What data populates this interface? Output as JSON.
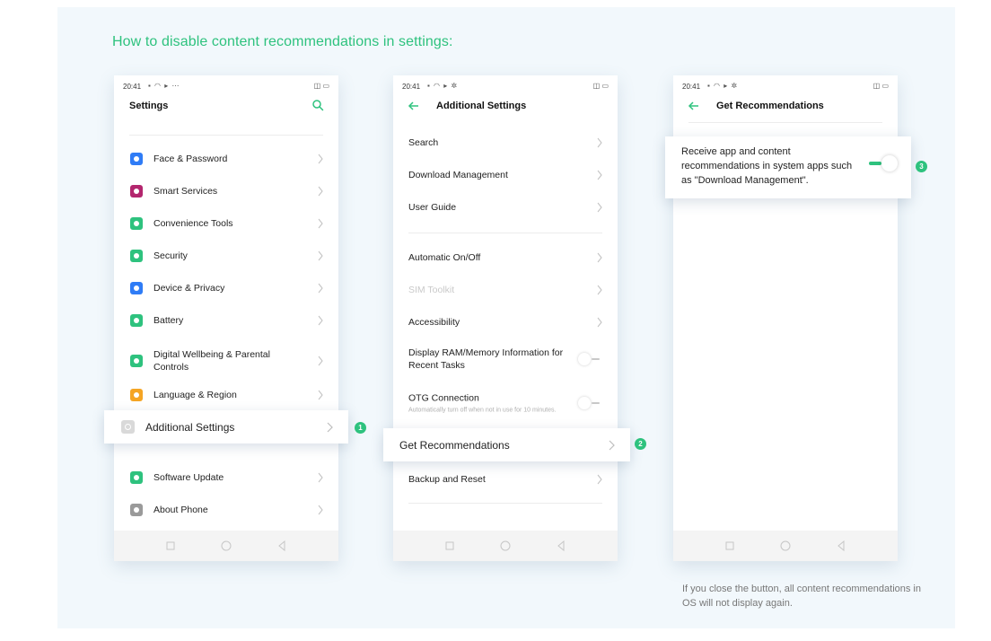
{
  "main_title": "How to disable content recommendations in settings:",
  "status": {
    "time": "20:41"
  },
  "colors": {
    "accent": "#2ec27e"
  },
  "phone1": {
    "title": "Settings",
    "items": [
      {
        "label": "Face & Password",
        "icon": "face-password-icon",
        "color": "#2f7cf6"
      },
      {
        "label": "Smart Services",
        "icon": "smart-services-icon",
        "color": "#b3266e"
      },
      {
        "label": "Convenience Tools",
        "icon": "convenience-tools-icon",
        "color": "#2ec27e"
      },
      {
        "label": "Security",
        "icon": "security-icon",
        "color": "#2ec27e"
      },
      {
        "label": "Device & Privacy",
        "icon": "device-privacy-icon",
        "color": "#2f7cf6"
      },
      {
        "label": "Battery",
        "icon": "battery-icon",
        "color": "#2ec27e"
      },
      {
        "label": "Digital Wellbeing & Parental Controls",
        "icon": "digital-wellbeing-icon",
        "color": "#2ec27e"
      },
      {
        "label": "Language & Region",
        "icon": "language-region-icon",
        "color": "#f5a524"
      }
    ],
    "callout_label": "Additional Settings",
    "bottom_items": [
      {
        "label": "Software Update",
        "icon": "software-update-icon",
        "color": "#2ec27e"
      },
      {
        "label": "About Phone",
        "icon": "about-phone-icon",
        "color": "#9a9a9a"
      }
    ]
  },
  "phone2": {
    "title": "Additional Settings",
    "group1": [
      "Search",
      "Download Management",
      "User Guide"
    ],
    "group2": [
      {
        "label": "Automatic On/Off",
        "type": "chevron"
      },
      {
        "label": "SIM Toolkit",
        "type": "chevron",
        "disabled": true
      },
      {
        "label": "Accessibility",
        "type": "chevron"
      },
      {
        "label": "Display RAM/Memory Information for Recent Tasks",
        "type": "switch"
      },
      {
        "label": "OTG Connection",
        "sub": "Automatically turn off when not in use for 10 minutes.",
        "type": "switch"
      }
    ],
    "callout_label": "Get Recommendations",
    "after": "Backup and Reset"
  },
  "phone3": {
    "title": "Get Recommendations",
    "callout_text": "Receive app and content recommendations in system apps such as \"Download Management\"."
  },
  "badges": [
    "1",
    "2",
    "3"
  ],
  "footnote": "If you close the button, all content recommendations in OS will not display again."
}
